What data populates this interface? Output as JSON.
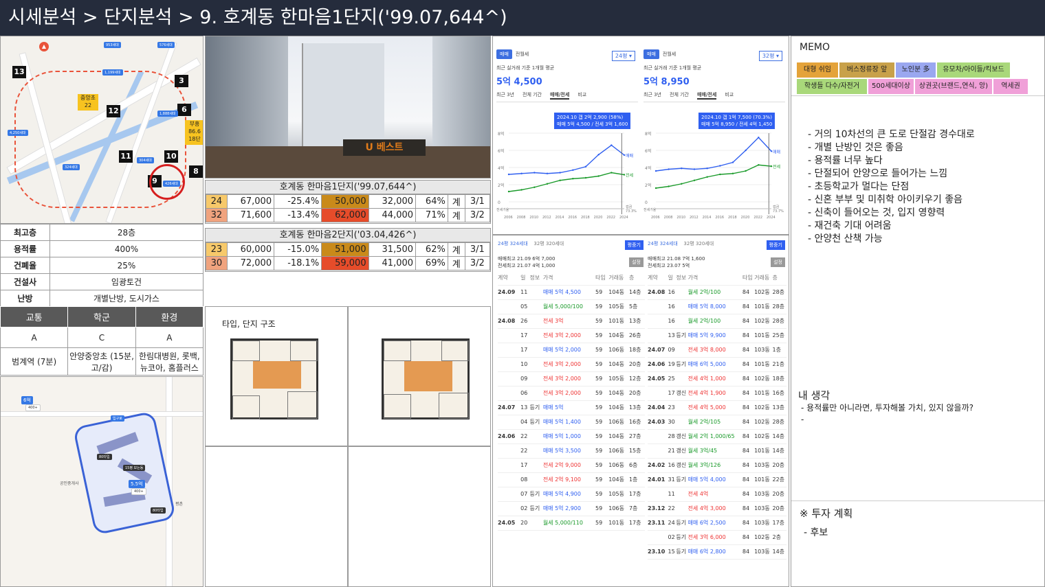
{
  "header": {
    "title": "시세분석 > 단지분석 > 9. 호계동 한마음1단지('99.07,644^)"
  },
  "map_top": {
    "numbers": [
      "13",
      "12",
      "3",
      "6",
      "11",
      "10",
      "9",
      "8"
    ],
    "labels": [
      "953세대",
      "576세대",
      "1,199세대",
      "부흥",
      "86.6",
      "18단",
      "중앙초",
      "22",
      "4,250세대",
      "1,888세대",
      "324세대",
      "304세대",
      "426세대",
      "안양천"
    ],
    "icons": [
      "school-icon",
      "bus-icon"
    ]
  },
  "info": [
    {
      "k": "최고층",
      "v": "28층"
    },
    {
      "k": "용적률",
      "v": "400%"
    },
    {
      "k": "건폐율",
      "v": "25%"
    },
    {
      "k": "건설사",
      "v": "임광토건"
    },
    {
      "k": "난방",
      "v": "개별난방, 도시가스"
    }
  ],
  "grade": {
    "headers": [
      "교통",
      "학군",
      "환경"
    ],
    "grades": [
      "A",
      "C",
      "A"
    ],
    "details": [
      "범계역 (7분)",
      "안양중앙초 (15분, 고/감)",
      "한림대병원, 롯백, 뉴코아, 홈플러스"
    ]
  },
  "map_bottom": {
    "labels": [
      "입구로",
      "6억",
      "400+",
      "80타입",
      "15평 보는동",
      "5.5억",
      "400+",
      "80타입",
      "공인중개사",
      "평촌"
    ]
  },
  "photo": {
    "sign": "U 베스트"
  },
  "price1": {
    "title": "호계동 한마음1단지('99.07,644^)",
    "rows": [
      [
        "24",
        "67,000",
        "-25.4%",
        "50,000",
        "32,000",
        "64%",
        "계",
        "3/1"
      ],
      [
        "32",
        "71,600",
        "-13.4%",
        "62,000",
        "44,000",
        "71%",
        "계",
        "3/2"
      ]
    ]
  },
  "price2": {
    "title": "호계동 한마음2단지('03.04,426^)",
    "rows": [
      [
        "23",
        "60,000",
        "-15.0%",
        "51,000",
        "31,500",
        "62%",
        "계",
        "3/1"
      ],
      [
        "30",
        "72,000",
        "-18.1%",
        "59,000",
        "41,000",
        "69%",
        "계",
        "3/2"
      ]
    ]
  },
  "colors": {
    "pyeong_small": "#f7c96a",
    "pyeong_large": "#f0a37e",
    "sale_a": "#c98a1a",
    "sale_b": "#e64c2a",
    "accent": "#2f5ff0"
  },
  "floorplan": {
    "title": "타입, 단지 구조"
  },
  "chart_left": {
    "tabs": [
      "매매",
      "전월세"
    ],
    "select": "24평",
    "avg_label": "최근 실거래 기준 1개월 평균",
    "price": "5억 4,500",
    "period_tabs": [
      "최근 3년",
      "전체 기간",
      "매매/전세",
      "비교"
    ],
    "tip": [
      "2024.10 갭 2억 2,900 (58%)",
      "매매 5억 4,500 / 전세 3억 1,600"
    ],
    "yticks": [
      "8억",
      "6억",
      "4억",
      "2억",
      "0"
    ],
    "xticks": [
      "2006",
      "2008",
      "2010",
      "2012",
      "2014",
      "2016",
      "2018",
      "2020",
      "2022",
      "2024"
    ],
    "series": [
      "매매",
      "전세"
    ],
    "gap_label": "전세가율",
    "gap_pct": "갭금",
    "extra": "73.3%"
  },
  "chart_right": {
    "tabs": [
      "매매",
      "전월세"
    ],
    "select": "32평",
    "avg_label": "최근 실거래 기준 1개월 평균",
    "price": "5억 8,950",
    "period_tabs": [
      "최근 3년",
      "전체 기간",
      "매매/전세",
      "비교"
    ],
    "tip": [
      "2024.10 갭 1억 7,500 (70.3%)",
      "매매 5억 8,950 / 전세 4억 1,450"
    ],
    "yticks": [
      "8억",
      "6억",
      "4억",
      "2억",
      "0"
    ],
    "xticks": [
      "2006",
      "2008",
      "2010",
      "2012",
      "2014",
      "2016",
      "2018",
      "2020",
      "2022",
      "2024"
    ],
    "series": [
      "매매",
      "전세"
    ],
    "gap_label": "전세가율",
    "gap_pct": "갭금",
    "extra": "73.7%"
  },
  "chart_data": [
    {
      "type": "line",
      "title": "24평 매매/전세",
      "x": [
        2006,
        2008,
        2010,
        2012,
        2014,
        2016,
        2018,
        2020,
        2022,
        2024
      ],
      "series": [
        {
          "name": "매매",
          "values": [
            3.2,
            3.3,
            3.4,
            3.3,
            3.4,
            3.7,
            4.1,
            5.5,
            6.6,
            5.45
          ]
        },
        {
          "name": "전세",
          "values": [
            1.2,
            1.4,
            1.7,
            2.1,
            2.5,
            2.7,
            2.8,
            3.0,
            3.4,
            3.16
          ]
        }
      ],
      "ylim": [
        0,
        8
      ]
    },
    {
      "type": "line",
      "title": "32평 매매/전세",
      "x": [
        2006,
        2008,
        2010,
        2012,
        2014,
        2016,
        2018,
        2020,
        2022,
        2024
      ],
      "series": [
        {
          "name": "매매",
          "values": [
            3.6,
            3.8,
            3.9,
            3.8,
            3.9,
            4.2,
            4.6,
            6.0,
            7.5,
            5.9
          ]
        },
        {
          "name": "전세",
          "values": [
            1.6,
            1.8,
            2.1,
            2.5,
            2.9,
            3.2,
            3.3,
            3.6,
            4.3,
            4.15
          ]
        }
      ],
      "ylim": [
        0,
        8
      ]
    }
  ],
  "deals_left": {
    "tabs": [
      "24평 324세대",
      "32평 320세대"
    ],
    "btn": "평중기",
    "set": "설정",
    "hi_sale": "매매최고 21.09 6억 7,000",
    "hi_jeonse": "전세최고 21.07 4억 1,000",
    "cols": [
      "계약",
      "일",
      "정보",
      "가격",
      "타입",
      "거래동",
      "층"
    ],
    "rows": [
      [
        "24.09",
        "11",
        "",
        "매매 5억 4,500",
        "59",
        "104동",
        "14층"
      ],
      [
        "",
        "05",
        "",
        "월세 5,000/100",
        "59",
        "105동",
        "5층"
      ],
      [
        "24.08",
        "26",
        "",
        "전세 3억",
        "59",
        "101동",
        "13층"
      ],
      [
        "",
        "17",
        "",
        "전세 3억 2,000",
        "59",
        "104동",
        "26층"
      ],
      [
        "",
        "17",
        "",
        "매매 5억 2,000",
        "59",
        "106동",
        "18층"
      ],
      [
        "",
        "10",
        "",
        "전세 3억 2,000",
        "59",
        "104동",
        "20층"
      ],
      [
        "",
        "09",
        "",
        "전세 3억 2,000",
        "59",
        "105동",
        "12층"
      ],
      [
        "",
        "06",
        "",
        "전세 3억 2,000",
        "59",
        "104동",
        "20층"
      ],
      [
        "24.07",
        "13",
        "등기",
        "매매 5억",
        "59",
        "104동",
        "13층"
      ],
      [
        "",
        "04",
        "등기",
        "매매 5억 1,400",
        "59",
        "106동",
        "16층"
      ],
      [
        "24.06",
        "22",
        "",
        "매매 5억 1,000",
        "59",
        "104동",
        "27층"
      ],
      [
        "",
        "22",
        "",
        "매매 5억 3,500",
        "59",
        "106동",
        "15층"
      ],
      [
        "",
        "17",
        "",
        "전세 2억 9,000",
        "59",
        "106동",
        "6층"
      ],
      [
        "",
        "08",
        "",
        "전세 2억 9,100",
        "59",
        "104동",
        "1층"
      ],
      [
        "",
        "07",
        "등기",
        "매매 5억 4,900",
        "59",
        "105동",
        "17층"
      ],
      [
        "",
        "02",
        "등기",
        "매매 5억 2,900",
        "59",
        "106동",
        "7층"
      ],
      [
        "24.05",
        "20",
        "",
        "월세 5,000/110",
        "59",
        "101동",
        "17층"
      ]
    ]
  },
  "deals_right": {
    "tabs": [
      "24평 324세대",
      "32평 320세대"
    ],
    "btn": "평중기",
    "set": "설정",
    "hi_sale": "매매최고 21.08 7억 1,600",
    "hi_jeonse": "전세최고 23.07 5억",
    "cols": [
      "계약",
      "일",
      "정보",
      "가격",
      "타입",
      "거래동",
      "층"
    ],
    "rows": [
      [
        "24.08",
        "16",
        "",
        "월세 2억/100",
        "84",
        "102동",
        "28층"
      ],
      [
        "",
        "16",
        "",
        "매매 5억 8,000",
        "84",
        "101동",
        "28층"
      ],
      [
        "",
        "16",
        "",
        "월세 2억/100",
        "84",
        "102동",
        "28층"
      ],
      [
        "",
        "13",
        "등기",
        "매매 5억 9,900",
        "84",
        "101동",
        "25층"
      ],
      [
        "24.07",
        "09",
        "",
        "전세 3억 8,000",
        "84",
        "103동",
        "1층"
      ],
      [
        "24.06",
        "19",
        "등기",
        "매매 6억 5,000",
        "84",
        "101동",
        "21층"
      ],
      [
        "24.05",
        "25",
        "",
        "전세 4억 1,000",
        "84",
        "102동",
        "18층"
      ],
      [
        "",
        "17",
        "갱신",
        "전세 4억 1,900",
        "84",
        "101동",
        "16층"
      ],
      [
        "24.04",
        "23",
        "",
        "전세 4억 5,000",
        "84",
        "102동",
        "13층"
      ],
      [
        "24.03",
        "30",
        "",
        "월세 2억/105",
        "84",
        "102동",
        "28층"
      ],
      [
        "",
        "28",
        "갱신",
        "월세 2억 1,000/65",
        "84",
        "102동",
        "14층"
      ],
      [
        "",
        "21",
        "갱신",
        "월세 3억/45",
        "84",
        "101동",
        "14층"
      ],
      [
        "24.02",
        "16",
        "갱신",
        "월세 3억/126",
        "84",
        "103동",
        "20층"
      ],
      [
        "24.01",
        "31",
        "등기",
        "매매 5억 4,000",
        "84",
        "101동",
        "22층"
      ],
      [
        "",
        "11",
        "",
        "전세 4억",
        "84",
        "103동",
        "20층"
      ],
      [
        "23.12",
        "22",
        "",
        "전세 4억 3,000",
        "84",
        "103동",
        "20층"
      ],
      [
        "23.11",
        "24",
        "등기",
        "매매 6억 2,500",
        "84",
        "103동",
        "17층"
      ],
      [
        "",
        "02",
        "등기",
        "전세 3억 6,000",
        "84",
        "102동",
        "2층"
      ],
      [
        "23.10",
        "15",
        "등기",
        "매매 6억 2,800",
        "84",
        "103동",
        "14층"
      ]
    ]
  },
  "memo": {
    "title": "MEMO",
    "tags": [
      "대형 쉬임",
      "버스정류장 앞",
      "노인분 多",
      "유모차/아이들/킥보드",
      "학생들 다수/자전거",
      "500세대이상",
      "상권곳(브랜드,연식, 앙)",
      "역세권"
    ],
    "items": [
      "거의 10차선의 큰 도로 단절감 경수대로",
      "개별 난방인 것은 좋음",
      "용적률 너무 높다",
      "단절되어 안양으로 들어가는 느낌",
      "초등학교가 멀다는 단점",
      "신혼 부부 및 미취학 아이키우기 좋음",
      "신축이 들어오는 것, 입지 영향력",
      "재건축 기대 어려움",
      "안양천 산책 가능"
    ],
    "thought_title": "내 생각",
    "thought_items": [
      "용적률만 아니라면, 투자해볼 가치, 있지 않을까?",
      ""
    ],
    "plan_title": "※ 투자 계획",
    "plan_items": [
      "후보"
    ]
  }
}
